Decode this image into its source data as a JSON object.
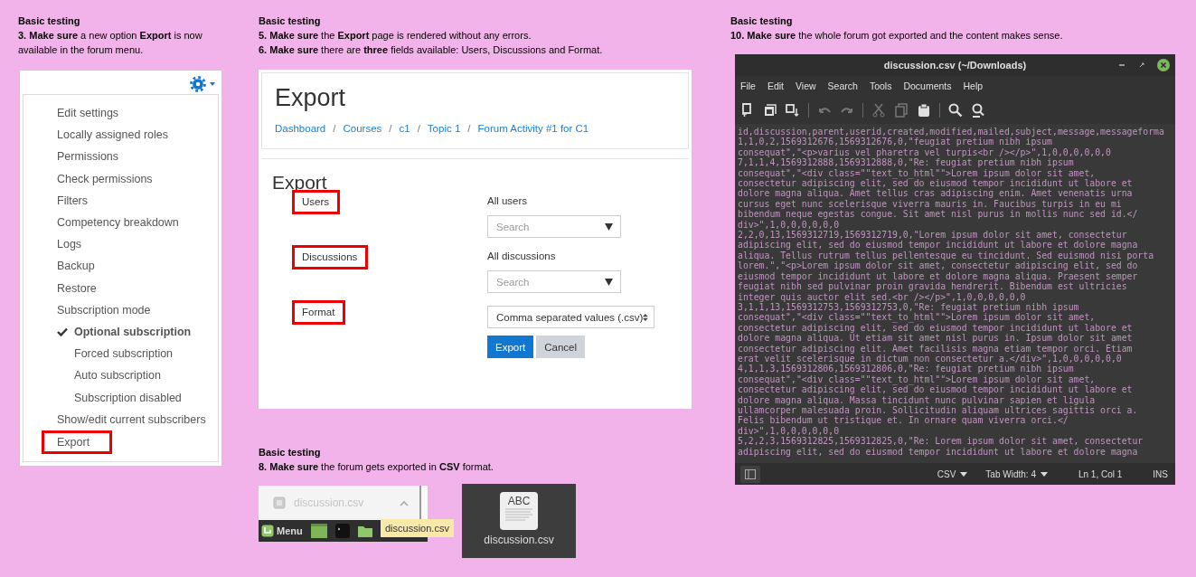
{
  "menu_panel": {
    "caption": {
      "heading": "Basic testing",
      "steps": [
        "**3. Make sure** a new option **Export** is now available in the forum menu."
      ]
    },
    "items": [
      {
        "label": "Edit settings",
        "highlighted": false
      },
      {
        "label": "Locally assigned roles",
        "highlighted": false
      },
      {
        "label": "Permissions",
        "highlighted": false
      },
      {
        "label": "Check permissions",
        "highlighted": false
      },
      {
        "label": "Filters",
        "highlighted": false
      },
      {
        "label": "Competency breakdown",
        "highlighted": false
      },
      {
        "label": "Logs",
        "highlighted": false
      },
      {
        "label": "Backup",
        "highlighted": false
      },
      {
        "label": "Restore",
        "highlighted": false
      },
      {
        "label": "Subscription mode",
        "highlighted": false,
        "children": [
          {
            "label": "Optional subscription",
            "checked": true
          },
          {
            "label": "Forced subscription",
            "checked": false
          },
          {
            "label": "Auto subscription",
            "checked": false
          },
          {
            "label": "Subscription disabled",
            "checked": false
          }
        ]
      },
      {
        "label": "Show/edit current subscribers",
        "highlighted": false
      },
      {
        "label": "Export",
        "highlighted": true
      }
    ]
  },
  "export_page": {
    "caption": {
      "heading": "Basic testing",
      "steps": [
        "**5. Make sure** the **Export** page is rendered without any errors.",
        "**6. Make sure** there are **three** fields available: Users, Discussions and Format."
      ]
    },
    "title": "Export",
    "breadcrumb": [
      "Dashboard",
      "Courses",
      "c1",
      "Topic 1",
      "Forum Activity #1 for C1"
    ],
    "breadcrumb_separator": "/",
    "form_title": "Export",
    "fields": [
      {
        "label": "Users",
        "highlighted": true,
        "kind": "autocomplete",
        "value": "All users",
        "placeholder": "Search"
      },
      {
        "label": "Discussions",
        "highlighted": true,
        "kind": "autocomplete",
        "value": "All discussions",
        "placeholder": "Search"
      },
      {
        "label": "Format",
        "highlighted": true,
        "kind": "select",
        "value": "Comma separated values (.csv)"
      }
    ],
    "buttons": [
      {
        "label": "Export",
        "kind": "primary"
      },
      {
        "label": "Cancel",
        "kind": "secondary"
      }
    ]
  },
  "download_panel": {
    "caption": {
      "heading": "Basic testing",
      "steps": [
        "**8. Make sure** the forum gets exported in **CSV** format."
      ]
    },
    "download_bar": {
      "file": "discussion.csv"
    },
    "taskbar": {
      "menu_label": "Menu",
      "tooltip": "discussion.csv"
    },
    "file_icon": {
      "preview": "ABC",
      "label": "discussion.csv"
    }
  },
  "editor": {
    "caption": {
      "heading": "Basic testing",
      "steps": [
        "**10. Make sure** the whole forum got exported and the content makes sense."
      ]
    },
    "title": "discussion.csv (~/Downloads)",
    "menu": [
      "File",
      "Edit",
      "View",
      "Search",
      "Tools",
      "Documents",
      "Help"
    ],
    "toolbar": [
      {
        "kind": "new",
        "disabled": false
      },
      {
        "kind": "open",
        "disabled": false
      },
      {
        "kind": "save",
        "disabled": false
      },
      {
        "kind": "separator"
      },
      {
        "kind": "undo",
        "disabled": true
      },
      {
        "kind": "redo",
        "disabled": true
      },
      {
        "kind": "separator"
      },
      {
        "kind": "cut",
        "disabled": true
      },
      {
        "kind": "copy",
        "disabled": true
      },
      {
        "kind": "paste",
        "disabled": false
      },
      {
        "kind": "separator"
      },
      {
        "kind": "find",
        "disabled": false
      },
      {
        "kind": "replace",
        "disabled": false
      }
    ],
    "lines": [
      "id,discussion,parent,userid,created,modified,mailed,subject,message,messageforma",
      "1,1,0,2,1569312676,1569312676,0,\"feugiat pretium nibh ipsum",
      "consequat\",\"<p>varius vel pharetra vel turpis<br /></p>\",1,0,0,0,0,0,0",
      "7,1,1,4,1569312888,1569312888,0,\"Re: feugiat pretium nibh ipsum",
      "consequat\",\"<div class=\"\"text_to_html\"\">Lorem ipsum dolor sit amet,",
      "consectetur adipiscing elit, sed do eiusmod tempor incididunt ut labore et",
      "dolore magna aliqua. Amet tellus cras adipiscing enim. Amet venenatis urna",
      "cursus eget nunc scelerisque viverra mauris in. Faucibus turpis in eu mi",
      "bibendum neque egestas congue. Sit amet nisl purus in mollis nunc sed id.</",
      "div>\",1,0,0,0,0,0,0",
      "2,2,0,13,1569312719,1569312719,0,\"Lorem ipsum dolor sit amet, consectetur",
      "adipiscing elit, sed do eiusmod tempor incididunt ut labore et dolore magna",
      "aliqua. Tellus rutrum tellus pellentesque eu tincidunt. Sed euismod nisi porta",
      "lorem.\",\"<p>Lorem ipsum dolor sit amet, consectetur adipiscing elit, sed do",
      "eiusmod tempor incididunt ut labore et dolore magna aliqua. Praesent semper",
      "feugiat nibh sed pulvinar proin gravida hendrerit. Bibendum est ultricies",
      "integer quis auctor elit sed.<br /></p>\",1,0,0,0,0,0,0",
      "3,1,1,13,1569312753,1569312753,0,\"Re: feugiat pretium nibh ipsum",
      "consequat\",\"<div class=\"\"text_to_html\"\">Lorem ipsum dolor sit amet,",
      "consectetur adipiscing elit, sed do eiusmod tempor incididunt ut labore et",
      "dolore magna aliqua. Ut etiam sit amet nisl purus in. Ipsum dolor sit amet",
      "consectetur adipiscing elit. Amet facilisis magna etiam tempor orci. Etiam",
      "erat velit scelerisque in dictum non consectetur a.</div>\",1,0,0,0,0,0,0",
      "4,1,1,3,1569312806,1569312806,0,\"Re: feugiat pretium nibh ipsum",
      "consequat\",\"<div class=\"\"text_to_html\"\">Lorem ipsum dolor sit amet,",
      "consectetur adipiscing elit, sed do eiusmod tempor incididunt ut labore et",
      "dolore magna aliqua. Massa tincidunt nunc pulvinar sapien et ligula",
      "ullamcorper malesuada proin. Sollicitudin aliquam ultrices sagittis orci a.",
      "Felis bibendum ut tristique et. In ornare quam viverra orci.</",
      "div>\",1,0,0,0,0,0,0",
      "5,2,2,3,1569312825,1569312825,0,\"Re: Lorem ipsum dolor sit amet, consectetur",
      "adipiscing elit, sed do eiusmod tempor incididunt ut labore et dolore magna"
    ],
    "status": {
      "language": "CSV",
      "tab_width": "Tab Width: 4",
      "position": "Ln 1, Col 1",
      "mode": "INS"
    }
  }
}
